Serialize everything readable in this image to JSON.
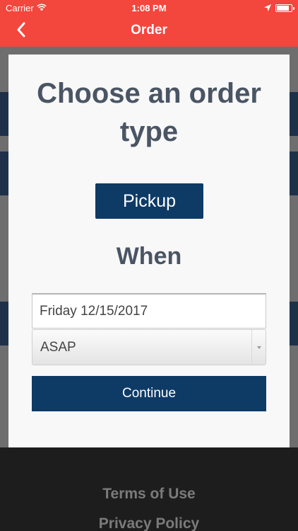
{
  "status_bar": {
    "carrier": "Carrier",
    "time": "1:08 PM",
    "icons": [
      "wifi-icon",
      "location-arrow-icon",
      "battery-icon"
    ]
  },
  "nav": {
    "title": "Order",
    "back_icon": "chevron-left-icon"
  },
  "modal": {
    "title": "Choose an order type",
    "order_type_button": "Pickup",
    "when_heading": "When",
    "date_value": "Friday 12/15/2017",
    "time_select_value": "ASAP",
    "continue_button": "Continue"
  },
  "footer": {
    "terms_link": "Terms of Use",
    "privacy_link": "Privacy Policy"
  },
  "colors": {
    "nav_bg": "#f3463d",
    "primary_button": "#0e3a66",
    "heading_text": "#4a5564",
    "modal_bg": "#f8f8f8"
  }
}
